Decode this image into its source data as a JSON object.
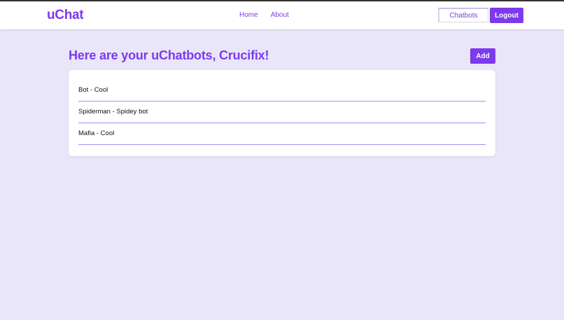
{
  "header": {
    "logo": "uChat",
    "nav": [
      "Home",
      "About"
    ],
    "chatbots_label": "Chatbots",
    "logout_label": "Logout"
  },
  "main": {
    "title": "Here are your uChatbots, Crucifix!",
    "add_label": "Add",
    "bots": [
      "Bot - Cool",
      "Spiderman - Spidey bot",
      "Mafia - Cool"
    ]
  },
  "colors": {
    "accent": "#7c3aed",
    "background": "#e9e6f9",
    "divider": "#a78bfa"
  }
}
